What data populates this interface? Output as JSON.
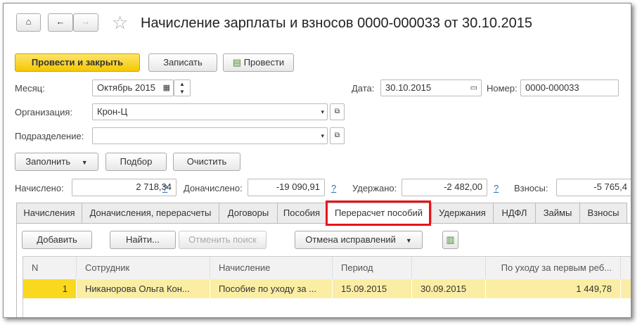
{
  "title": "Начисление зарплаты и взносов 0000-000033 от 30.10.2015",
  "toolbar": {
    "post_close": "Провести и закрыть",
    "save": "Записать",
    "post": "Провести"
  },
  "fields": {
    "month_label": "Месяц:",
    "month": "Октябрь 2015",
    "date_label": "Дата:",
    "date": "30.10.2015",
    "number_label": "Номер:",
    "number": "0000-000033",
    "org_label": "Организация:",
    "org": "Крон-Ц",
    "dept_label": "Подразделение:",
    "dept": ""
  },
  "actions": {
    "fill": "Заполнить",
    "select": "Подбор",
    "clear": "Очистить"
  },
  "totals": {
    "accrued_label": "Начислено:",
    "accrued": "2 718,34",
    "additional_label": "Доначислено:",
    "additional": "-19 090,91",
    "withheld_label": "Удержано:",
    "withheld": "-2 482,00",
    "contrib_label": "Взносы:",
    "contrib": "-5 765,4",
    "help": "?"
  },
  "tabs": [
    "Начисления",
    "Доначисления, перерасчеты",
    "Договоры",
    "Пособия",
    "Перерасчет пособий",
    "Удержания",
    "НДФЛ",
    "Займы",
    "Взносы"
  ],
  "active_tab": "Перерасчет пособий",
  "panel": {
    "add": "Добавить",
    "find": "Найти...",
    "cancel_search": "Отменить поиск",
    "cancel_corrections": "Отмена исправлений"
  },
  "table": {
    "columns": [
      "N",
      "Сотрудник",
      "Начисление",
      "Период",
      "",
      "По уходу за первым реб..."
    ],
    "rows": [
      [
        "1",
        "Никанорова Ольга Кон...",
        "Пособие по уходу за ...",
        "15.09.2015",
        "30.09.2015",
        "1 449,78"
      ]
    ]
  }
}
